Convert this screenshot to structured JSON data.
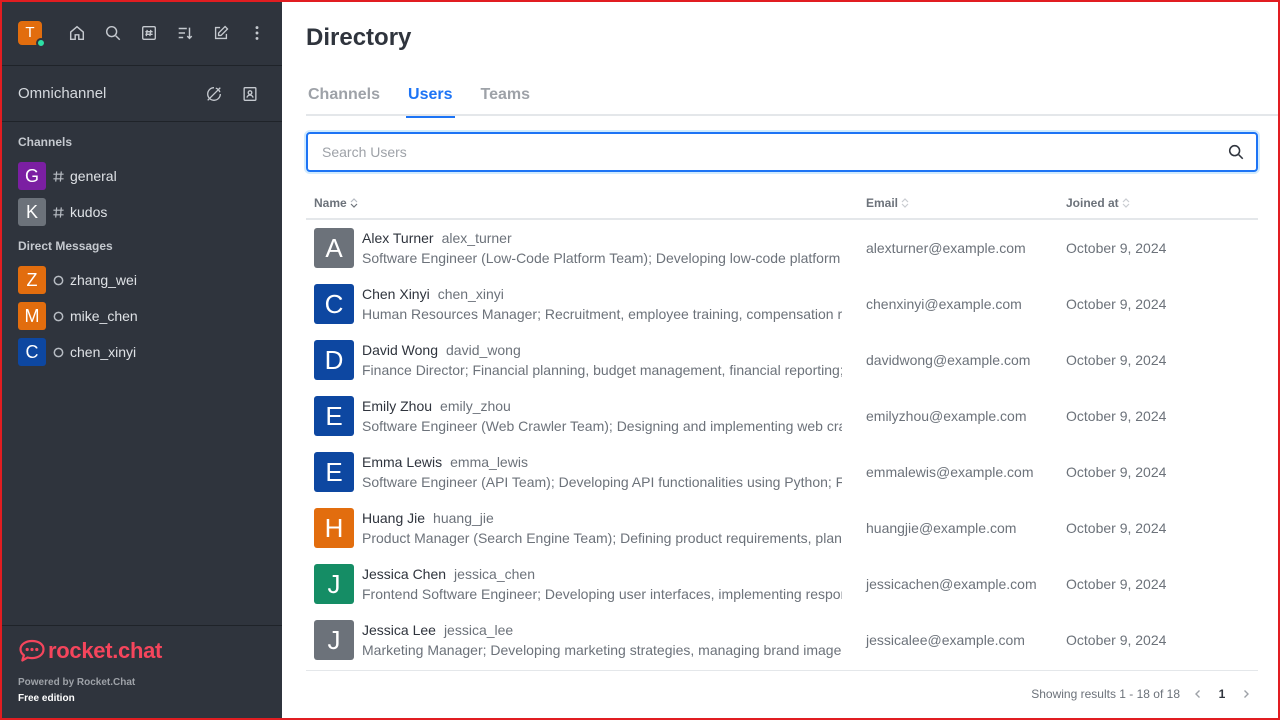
{
  "sidebar": {
    "user_initial": "T",
    "user_avatar_color": "#e26d0e",
    "status_color": "#2de0a5",
    "top_icons": [
      "home-icon",
      "search-icon",
      "directory-icon",
      "sort-icon",
      "create-new-icon",
      "kebab-menu-icon"
    ],
    "omnichannel_label": "Omnichannel",
    "channels_title": "Channels",
    "channels": [
      {
        "initial": "G",
        "name": "general",
        "color": "#7b1fa2"
      },
      {
        "initial": "K",
        "name": "kudos",
        "color": "#6c727a"
      }
    ],
    "dm_title": "Direct Messages",
    "direct_messages": [
      {
        "initial": "Z",
        "name": "zhang_wei",
        "color": "#e26d0e"
      },
      {
        "initial": "M",
        "name": "mike_chen",
        "color": "#e26d0e"
      },
      {
        "initial": "C",
        "name": "chen_xinyi",
        "color": "#0d47a1"
      }
    ],
    "brand": "rocket.chat",
    "powered_by": "Powered by Rocket.Chat",
    "edition": "Free edition"
  },
  "main": {
    "title": "Directory",
    "tabs": [
      {
        "label": "Channels"
      },
      {
        "label": "Users"
      },
      {
        "label": "Teams"
      }
    ],
    "search_placeholder": "Search Users",
    "columns": {
      "name": "Name",
      "email": "Email",
      "joined": "Joined at"
    },
    "users": [
      {
        "initial": "A",
        "color": "#6c727a",
        "name": "Alex Turner",
        "username": "alex_turner",
        "bio": "Software Engineer (Low-Code Platform Team); Developing low-code platform",
        "email": "alexturner@example.com",
        "joined": "October 9, 2024"
      },
      {
        "initial": "C",
        "color": "#0d47a1",
        "name": "Chen Xinyi",
        "username": "chen_xinyi",
        "bio": "Human Resources Manager; Recruitment, employee training, compensation r",
        "email": "chenxinyi@example.com",
        "joined": "October 9, 2024"
      },
      {
        "initial": "D",
        "color": "#0d47a1",
        "name": "David Wong",
        "username": "david_wong",
        "bio": "Finance Director; Financial planning, budget management, financial reporting;",
        "email": "davidwong@example.com",
        "joined": "October 9, 2024"
      },
      {
        "initial": "E",
        "color": "#0d47a1",
        "name": "Emily Zhou",
        "username": "emily_zhou",
        "bio": "Software Engineer (Web Crawler Team); Designing and implementing web cra",
        "email": "emilyzhou@example.com",
        "joined": "October 9, 2024"
      },
      {
        "initial": "E",
        "color": "#0d47a1",
        "name": "Emma Lewis",
        "username": "emma_lewis",
        "bio": "Software Engineer (API Team); Developing API functionalities using Python; F",
        "email": "emmalewis@example.com",
        "joined": "October 9, 2024"
      },
      {
        "initial": "H",
        "color": "#e26d0e",
        "name": "Huang Jie",
        "username": "huang_jie",
        "bio": "Product Manager (Search Engine Team); Defining product requirements, plan",
        "email": "huangjie@example.com",
        "joined": "October 9, 2024"
      },
      {
        "initial": "J",
        "color": "#158d65",
        "name": "Jessica Chen",
        "username": "jessica_chen",
        "bio": "Frontend Software Engineer; Developing user interfaces, implementing respor",
        "email": "jessicachen@example.com",
        "joined": "October 9, 2024"
      },
      {
        "initial": "J",
        "color": "#6c727a",
        "name": "Jessica Lee",
        "username": "jessica_lee",
        "bio": "Marketing Manager; Developing marketing strategies, managing brand image",
        "email": "jessicalee@example.com",
        "joined": "October 9, 2024"
      }
    ],
    "pagination": {
      "summary": "Showing results 1 - 18 of 18",
      "current_page": "1"
    }
  }
}
